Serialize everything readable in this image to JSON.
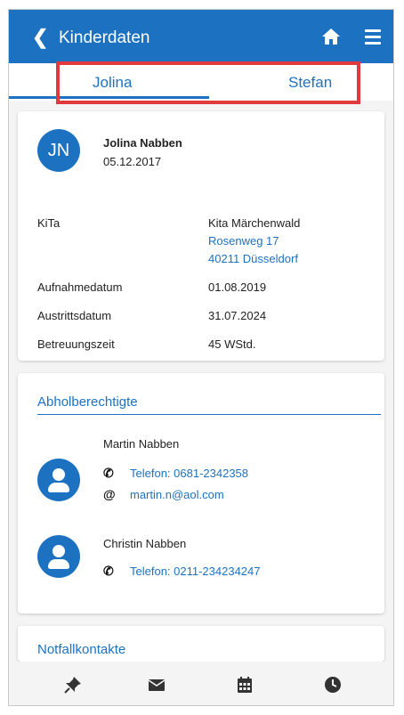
{
  "appbar": {
    "back_icon": "chevron-left-icon",
    "title": "Kinderdaten",
    "home_icon": "home-icon",
    "menu_icon": "hamburger-menu-icon"
  },
  "tabs": [
    {
      "label": "Jolina"
    },
    {
      "label": "Stefan"
    }
  ],
  "child": {
    "initials": "JN",
    "name": "Jolina Nabben",
    "birthdate": "05.12.2017",
    "fields": {
      "kita_label": "KiTa",
      "kita_name": "Kita Märchenwald",
      "kita_street": "Rosenweg 17",
      "kita_city": "40211 Düsseldorf",
      "aufnahme_label": "Aufnahmedatum",
      "aufnahme_value": "01.08.2019",
      "austritt_label": "Austrittsdatum",
      "austritt_value": "31.07.2024",
      "betreuung_label": "Betreuungszeit",
      "betreuung_value": "45 WStd."
    }
  },
  "pickup": {
    "title": "Abholberechtigte",
    "persons": [
      {
        "name": "Martin Nabben",
        "phone": "Telefon: 0681-2342358",
        "email": "martin.n@aol.com",
        "phone_icon": "phone-icon",
        "email_icon": "at-icon"
      },
      {
        "name": "Christin Nabben",
        "phone": "Telefon: 0211-234234247",
        "phone_icon": "phone-icon"
      }
    ]
  },
  "emergency": {
    "title": "Notfallkontakte"
  },
  "bottom_nav": {
    "items": [
      "pin-icon",
      "mail-icon",
      "calendar-icon",
      "clock-icon"
    ]
  },
  "colors": {
    "primary": "#1c72c1",
    "highlight": "#e0393e"
  }
}
